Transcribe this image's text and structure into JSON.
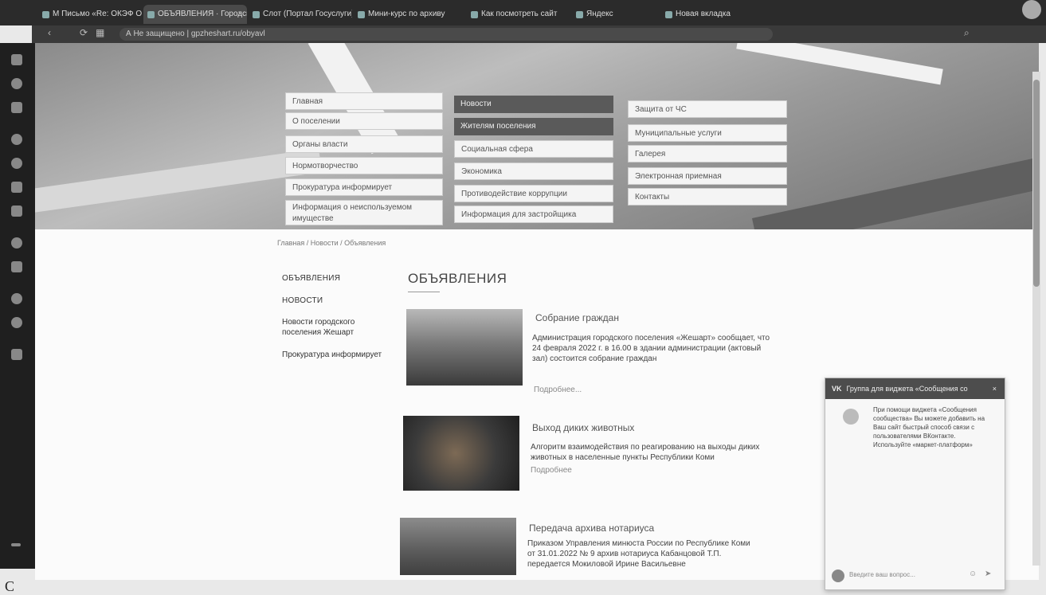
{
  "browser": {
    "tabs": [
      {
        "label": "M Письмо «Re: ОКЭФ ОК",
        "active": false
      },
      {
        "label": "ОБЪЯВЛЕНИЯ · Городск",
        "active": true
      },
      {
        "label": "Слот (Портал Госуслуги)",
        "active": false
      },
      {
        "label": "Мини-курс по архиву",
        "active": false
      },
      {
        "label": "Как посмотреть сайт",
        "active": false
      },
      {
        "label": "Яндекс",
        "active": false
      },
      {
        "label": "Новая вкладка",
        "active": false
      }
    ],
    "url": "А Не защищено | gpzheshart.ru/obyavl"
  },
  "top_menu": {
    "col1": [
      "Главная",
      "О поселении",
      "Органы власти",
      "Нормотворчество",
      "Прокуратура информирует",
      "Информация о неиспользуемом имуществе"
    ],
    "col2": [
      "Новости",
      "Жителям поселения",
      "Социальная сфера",
      "Экономика",
      "Противодействие коррупции",
      "Информация для застройщика"
    ],
    "col3": [
      "Защита от ЧС",
      "Муниципальные услуги",
      "Галерея",
      "Электронная приемная",
      "Контакты"
    ]
  },
  "breadcrumb": [
    "Главная",
    "Новости",
    "Объявления"
  ],
  "section_nav": {
    "items": [
      "ОБЪЯВЛЕНИЯ",
      "НОВОСТИ",
      "Новости городского поселения Жешарт",
      "Прокуратура информирует"
    ]
  },
  "page_title": "ОБЪЯВЛЕНИЯ",
  "news": [
    {
      "title": "Собрание граждан",
      "body": "Администрация городского поселения «Жешарт» сообщает, что 24 февраля 2022 г. в 16.00 в здании администрации (актовый зал) состоится собрание граждан",
      "more": "Подробнее..."
    },
    {
      "title": "Выход диких животных",
      "body": "Алгоритм взаимодействия по реагированию на выходы диких животных в населенные пункты Республики Коми",
      "more": "Подробнее"
    },
    {
      "title": "Передача архива нотариуса",
      "body": "Приказом Управления минюста России по Республике Коми от 31.01.2022 № 9 архив нотариуса Кабанцовой Т.П. передается Мокиловой Ирине Васильевне",
      "more": ""
    }
  ],
  "vk_widget": {
    "header": "Группа для виджета «Сообщения со",
    "message": "При помощи виджета «Сообщения сообщества» Вы можете добавить на Ваш сайт быстрый способ связи с пользователями ВКонтакте. Используйте «маркет-платформ»",
    "input_placeholder": "Введите ваш вопрос..."
  },
  "caption": "С"
}
